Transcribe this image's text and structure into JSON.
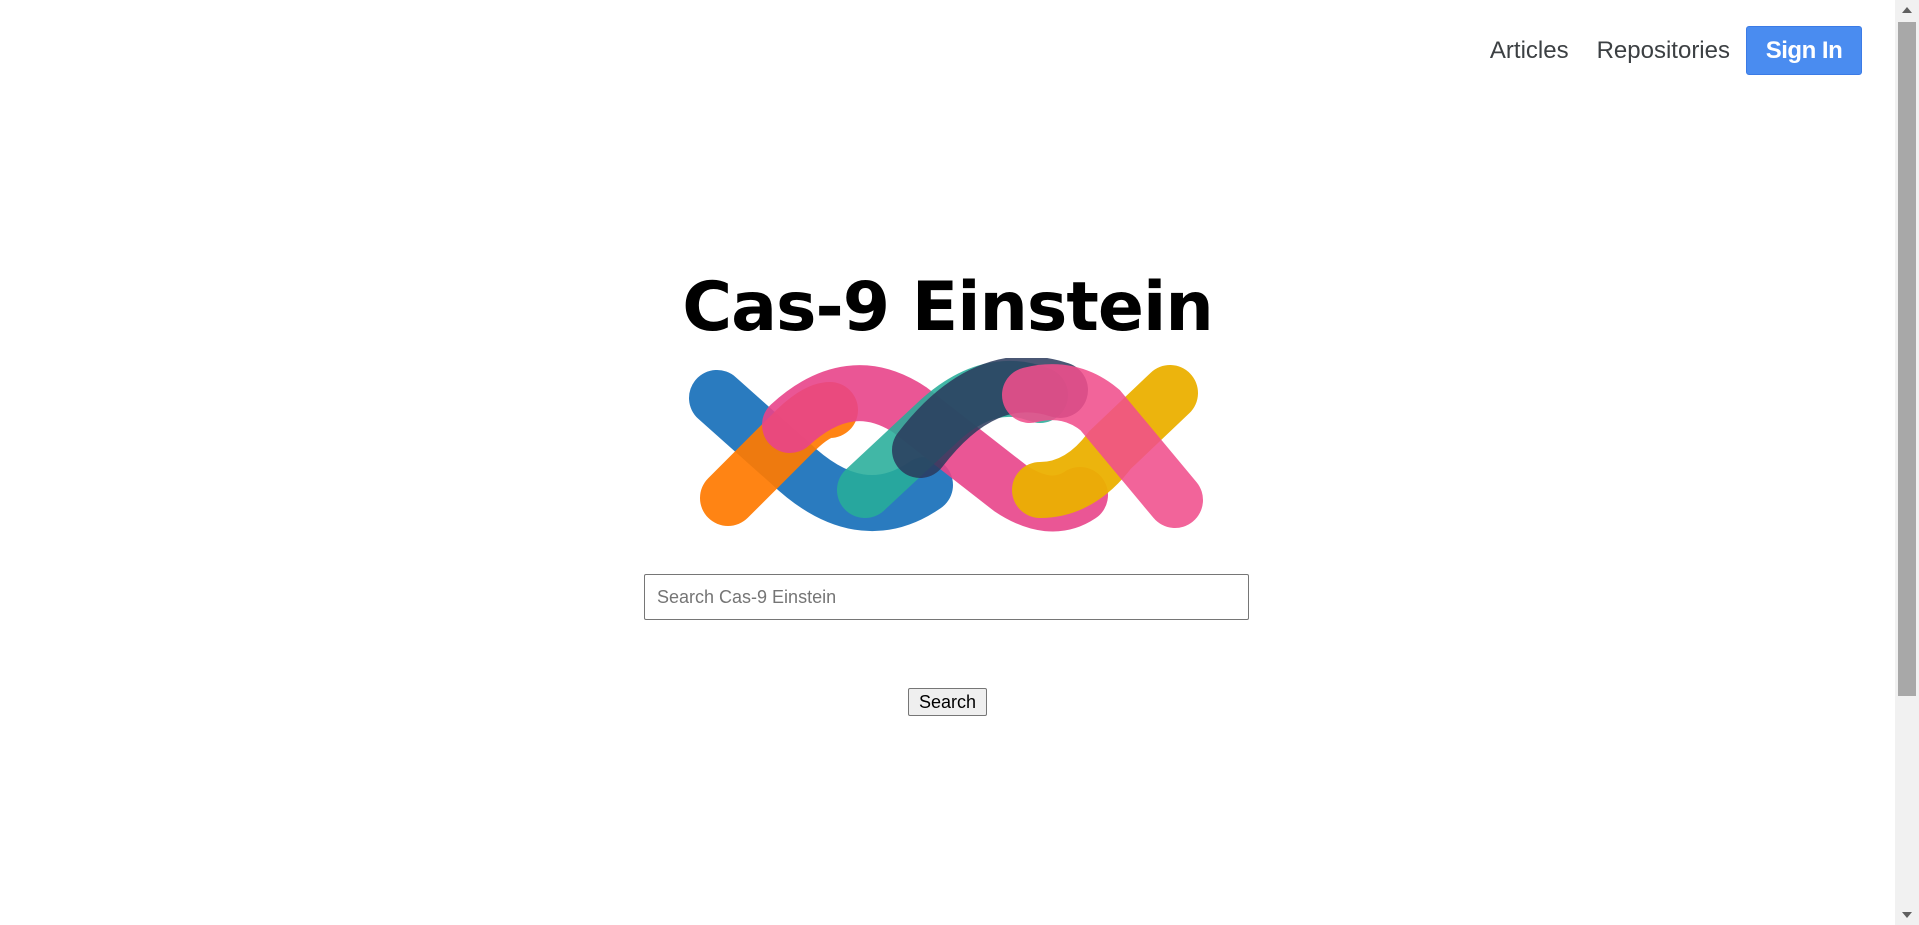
{
  "nav": {
    "articles_label": "Articles",
    "repositories_label": "Repositories",
    "signin_label": "Sign In"
  },
  "brand": {
    "title": "Cas-9 Einstein",
    "logo_icon": "dna-double-helix-logo"
  },
  "search": {
    "placeholder": "Search Cas-9 Einstein",
    "value": "",
    "button_label": "Search"
  },
  "colors": {
    "accent": "#4a8cf0",
    "logo_blue": "#2a7bbf",
    "logo_orange": "#ff7a00",
    "logo_pink": "#ef4b87",
    "logo_navy": "#2a3a5c",
    "logo_teal": "#27ad9a",
    "logo_yellow": "#ebb000",
    "logo_red": "#cf2200",
    "logo_green": "#2a5a08"
  }
}
